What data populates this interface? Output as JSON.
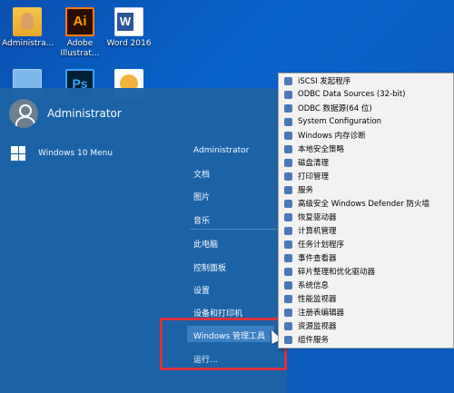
{
  "desktop": {
    "icons": [
      {
        "label": "Administra...",
        "icon": "user-folder-icon"
      },
      {
        "label": "Adobe Illustrat...",
        "icon": "illustrator-icon",
        "glyph": "Ai"
      },
      {
        "label": "Word 2016",
        "icon": "word-icon"
      },
      {
        "label": "",
        "icon": "generic-app-icon"
      },
      {
        "label": "",
        "icon": "photoshop-icon",
        "glyph": "Ps"
      },
      {
        "label": "",
        "icon": "game-icon"
      }
    ]
  },
  "start_menu": {
    "user_name": "Administrator",
    "app_item": "Windows 10 Menu",
    "right_items": [
      "Administrator",
      "文档",
      "图片",
      "音乐",
      "此电脑",
      "控制面板",
      "设置",
      "设备和打印机",
      "Windows 管理工具",
      "运行..."
    ],
    "highlighted": "Windows 管理工具"
  },
  "submenu": {
    "items": [
      "iSCSI 发起程序",
      "ODBC Data Sources (32-bit)",
      "ODBC 数据源(64 位)",
      "System Configuration",
      "Windows 内存诊断",
      "本地安全策略",
      "磁盘清理",
      "打印管理",
      "服务",
      "高级安全 Windows Defender 防火墙",
      "恢复驱动器",
      "计算机管理",
      "任务计划程序",
      "事件查看器",
      "碎片整理和优化驱动器",
      "系统信息",
      "性能监视器",
      "注册表编辑器",
      "资源监视器",
      "组件服务"
    ]
  },
  "colors": {
    "desktop": "#0863c9",
    "start_menu": "#1d63a7",
    "highlight": "#3c7fc2",
    "annotation_box": "#e0323a",
    "submenu_bg": "#f2f2f2"
  }
}
